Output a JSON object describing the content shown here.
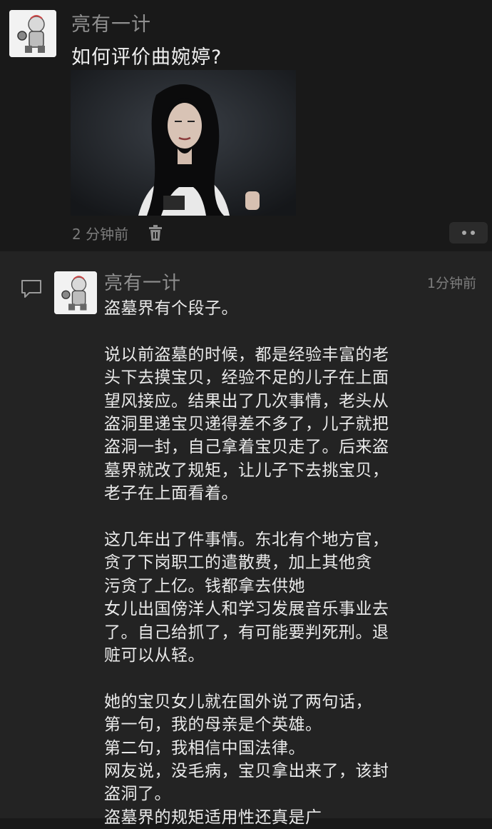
{
  "post": {
    "author": "亮有一计",
    "text": "如何评价曲婉婷?",
    "time": "2 分钟前",
    "icons": {
      "avatar": "cartoon-avatar",
      "delete": "trash-icon",
      "more": "more-icon"
    }
  },
  "comment": {
    "author": "亮有一计",
    "time": "1分钟前",
    "lines": [
      "盗墓界有个段子。",
      "",
      "说以前盗墓的时候，都是经验丰富的老",
      "头下去摸宝贝，经验不足的儿子在上面",
      "望风接应。结果出了几次事情，老头从",
      "盗洞里递宝贝递得差不多了，儿子就把",
      "盗洞一封，自己拿着宝贝走了。后来盗",
      "墓界就改了规矩，让儿子下去挑宝贝，",
      "老子在上面看着。",
      "",
      "这几年出了件事情。东北有个地方官，",
      "贪了下岗职工的遣散费，加上其他贪",
      "污贪了上亿。钱都拿去供她",
      "女儿出国傍洋人和学习发展音乐事业去",
      "了。自己给抓了，有可能要判死刑。退",
      "赃可以从轻。",
      "",
      "她的宝贝女儿就在国外说了两句话，",
      "第一句，我的母亲是个英雄。",
      "第二句，我相信中国法律。",
      "网友说，没毛病，宝贝拿出来了，该封",
      "盗洞了。",
      "盗墓界的规矩适用性还真是广"
    ],
    "icons": {
      "comment": "comment-bubble-icon"
    }
  }
}
